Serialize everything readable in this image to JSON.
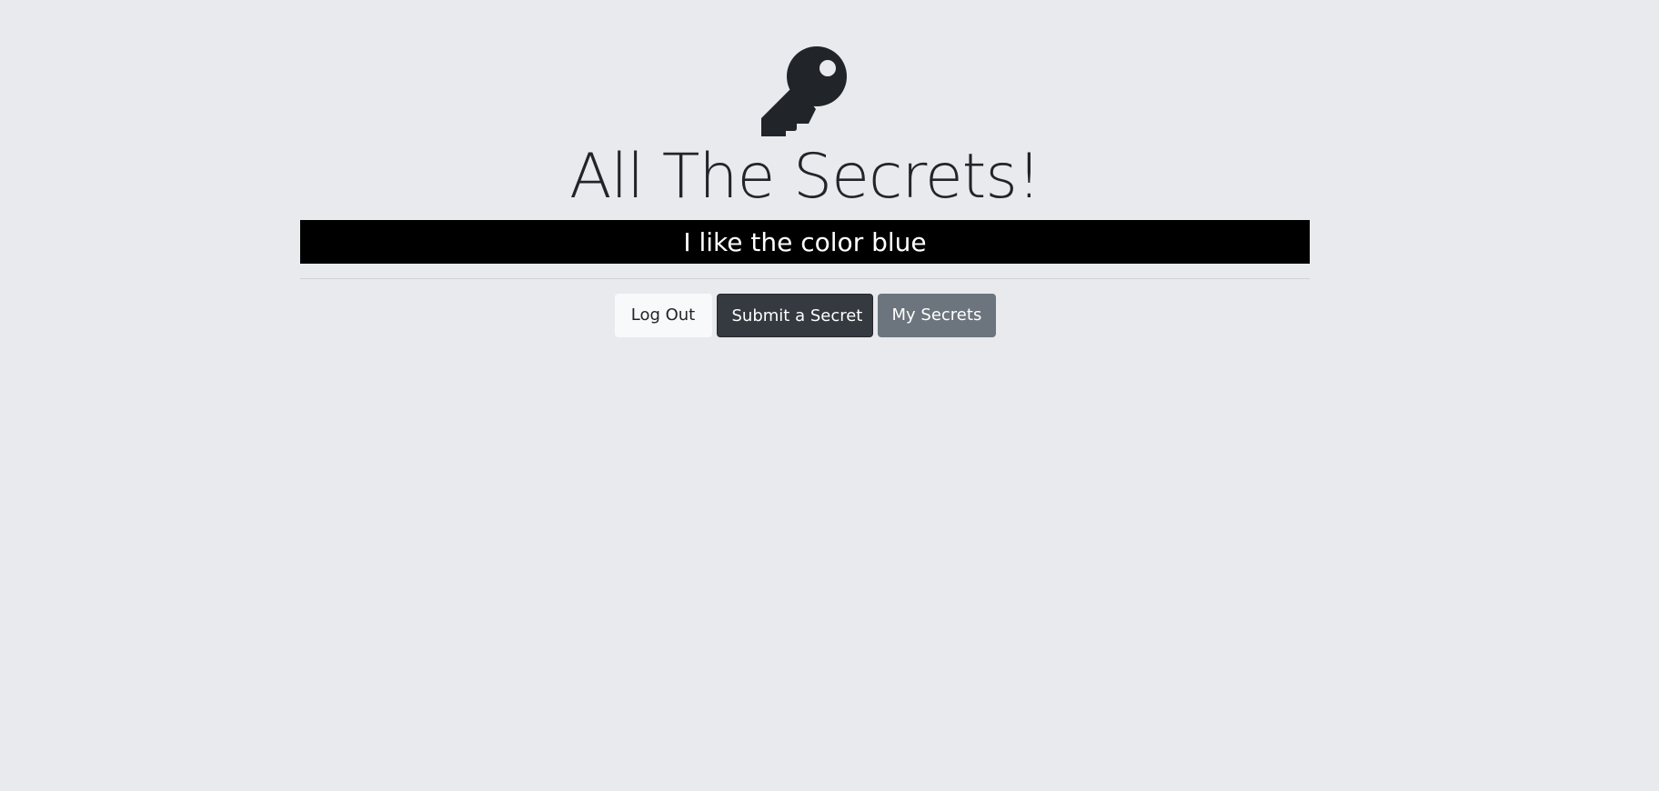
{
  "header": {
    "icon": "key-icon",
    "title": "All The Secrets!"
  },
  "secret": {
    "text": "I like the color blue"
  },
  "actions": {
    "logout_label": "Log Out",
    "submit_label": "Submit a Secret",
    "my_secrets_label": "My Secrets"
  },
  "colors": {
    "background": "#e9eaed",
    "secret_bar": "#000000",
    "logout_button": "#f8f9fa",
    "submit_button": "#343a40",
    "my_secrets_button": "#6c757d"
  }
}
